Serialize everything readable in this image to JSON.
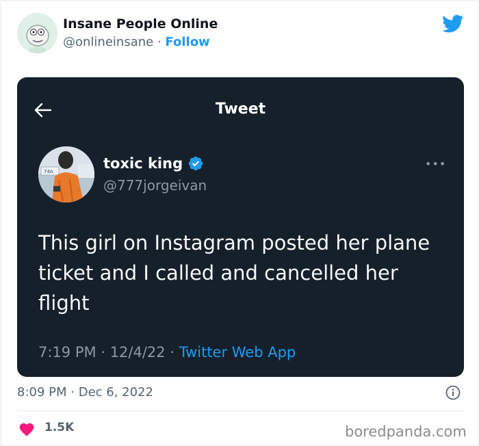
{
  "author": {
    "name": "Insane People Online",
    "handle": "@onlineinsane",
    "separator": "·",
    "follow_label": "Follow"
  },
  "embedded_tweet": {
    "header_title": "Tweet",
    "user_name": "toxic king",
    "user_handle": "@777jorgeivan",
    "more_label": "•••",
    "text": "This girl on Instagram posted her plane ticket and I called and cancelled her flight",
    "time": "7:19 PM",
    "separator_1": "·",
    "date": "12/4/22",
    "separator_2": "·",
    "app": "Twitter Web App"
  },
  "footer": {
    "time": "8:09 PM",
    "separator": "·",
    "date": "Dec 6, 2022",
    "like_count": "1.5K"
  },
  "watermark": "boredpanda.com",
  "colors": {
    "accent": "#1d9bf0",
    "dark_bg": "#15202b",
    "heart": "#f91880",
    "muted": "#536471"
  },
  "icons": [
    "twitter-bird-icon",
    "back-arrow-icon",
    "verified-badge-icon",
    "more-dots-icon",
    "info-icon",
    "heart-icon"
  ]
}
